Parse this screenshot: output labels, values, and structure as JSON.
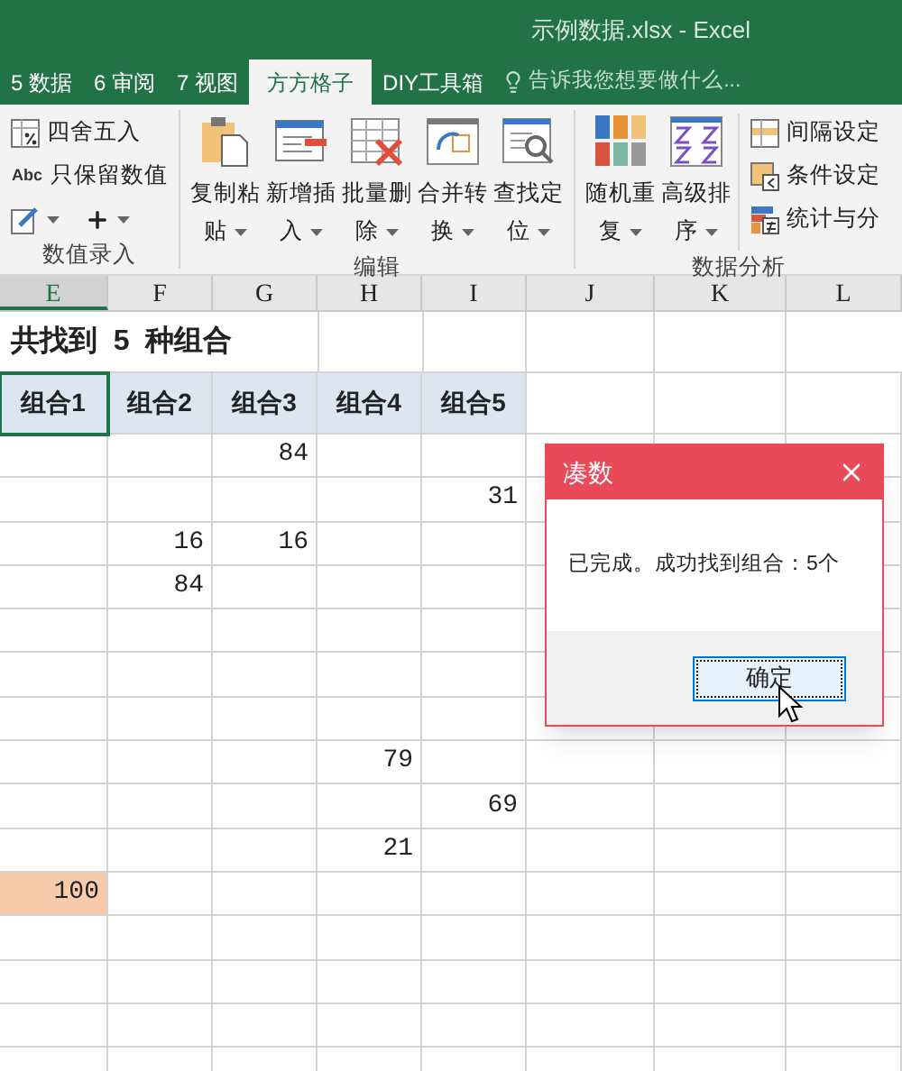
{
  "window": {
    "title": "示例数据.xlsx - Excel"
  },
  "tabs": [
    {
      "label": "5 数据",
      "selected": false
    },
    {
      "label": "6 审阅",
      "selected": false
    },
    {
      "label": "7 视图",
      "selected": false
    },
    {
      "label": "方方格子",
      "selected": true
    },
    {
      "label": "DIY工具箱",
      "selected": false
    }
  ],
  "tell_me": {
    "placeholder": "告诉我您想要做什么..."
  },
  "ribbon": {
    "groups": [
      {
        "label": "数值录入",
        "small_items": [
          {
            "kind": "round",
            "label": "四舍五入"
          },
          {
            "kind": "text",
            "icon_text": "Abc",
            "label": "只保留数值"
          },
          {
            "kind": "pair"
          }
        ]
      },
      {
        "label": "编辑",
        "large_items": [
          {
            "kind": "paste",
            "lines": [
              "复制粘",
              "贴"
            ]
          },
          {
            "kind": "insert",
            "lines": [
              "新增插",
              "入"
            ]
          },
          {
            "kind": "delete",
            "lines": [
              "批量删",
              "除"
            ]
          },
          {
            "kind": "merge",
            "lines": [
              "合并转",
              "换"
            ]
          },
          {
            "kind": "find",
            "lines": [
              "查找定",
              "位"
            ]
          }
        ]
      },
      {
        "label": "数据分析",
        "large_items": [
          {
            "kind": "random",
            "lines": [
              "随机重",
              "复"
            ]
          },
          {
            "kind": "sort",
            "lines": [
              "高级排",
              "序"
            ]
          }
        ],
        "small_items": [
          {
            "kind": "interval",
            "label": "间隔设定"
          },
          {
            "kind": "condition",
            "label": "条件设定"
          },
          {
            "kind": "stats",
            "label": "统计与分"
          }
        ]
      }
    ]
  },
  "sheet": {
    "columns": [
      {
        "label": "E",
        "selected": true
      },
      {
        "label": "F",
        "selected": false
      },
      {
        "label": "G",
        "selected": false
      },
      {
        "label": "H",
        "selected": false
      },
      {
        "label": "I",
        "selected": false
      },
      {
        "label": "J",
        "selected": false
      },
      {
        "label": "K",
        "selected": false
      },
      {
        "label": "L",
        "selected": false
      }
    ],
    "rows": [
      {
        "kind": "title",
        "cells": {
          "E": {
            "text": "共找到  5  种组合"
          }
        }
      },
      {
        "kind": "header",
        "cells": {
          "E": {
            "text": "组合1",
            "selected": true
          },
          "F": {
            "text": "组合2",
            "selected": false
          },
          "G": {
            "text": "组合3",
            "selected": false
          },
          "H": {
            "text": "组合4",
            "selected": false
          },
          "I": {
            "text": "组合5",
            "selected": false
          }
        }
      },
      {
        "kind": "data",
        "cells": {
          "G": {
            "text": "84"
          }
        }
      },
      {
        "kind": "data",
        "cells": {
          "I": {
            "text": "31"
          }
        }
      },
      {
        "kind": "data",
        "cells": {
          "F": {
            "text": "16"
          },
          "G": {
            "text": "16"
          }
        }
      },
      {
        "kind": "data",
        "cells": {
          "F": {
            "text": "84"
          }
        }
      },
      {
        "kind": "data"
      },
      {
        "kind": "data"
      },
      {
        "kind": "data"
      },
      {
        "kind": "data",
        "cells": {
          "H": {
            "text": "79"
          }
        }
      },
      {
        "kind": "data",
        "cells": {
          "I": {
            "text": "69"
          }
        }
      },
      {
        "kind": "data",
        "cells": {
          "H": {
            "text": "21"
          }
        }
      },
      {
        "kind": "data",
        "cells": {
          "E": {
            "text": "100",
            "highlighted": true
          }
        }
      },
      {
        "kind": "data"
      },
      {
        "kind": "data"
      },
      {
        "kind": "data"
      },
      {
        "kind": "data"
      }
    ]
  },
  "dialog": {
    "title": "凑数",
    "message": "已完成。成功找到组合：5个",
    "button": "确定"
  }
}
